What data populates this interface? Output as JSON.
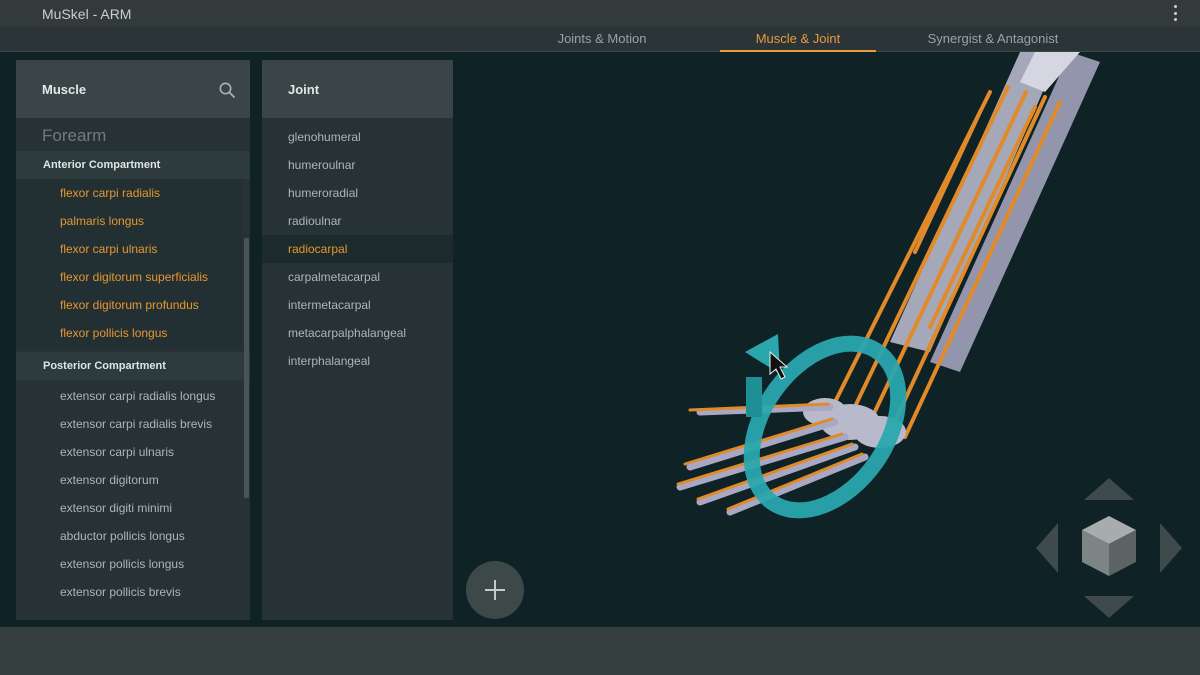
{
  "app": {
    "title": "MuSkel - ARM"
  },
  "tabs": [
    {
      "label": "Joints & Motion"
    },
    {
      "label": "Muscle & Joint"
    },
    {
      "label": "Synergist & Antagonist"
    }
  ],
  "muscle_panel": {
    "title": "Muscle",
    "group": "Forearm",
    "sections": [
      {
        "title": "Anterior Compartment",
        "items": [
          {
            "label": "flexor carpi radialis"
          },
          {
            "label": "palmaris longus"
          },
          {
            "label": "flexor carpi ulnaris"
          },
          {
            "label": "flexor digitorum superficialis"
          },
          {
            "label": "flexor digitorum profundus"
          },
          {
            "label": "flexor pollicis longus"
          }
        ]
      },
      {
        "title": "Posterior Compartment",
        "items": [
          {
            "label": "extensor carpi radialis longus"
          },
          {
            "label": "extensor carpi radialis brevis"
          },
          {
            "label": "extensor carpi ulnaris"
          },
          {
            "label": "extensor digitorum"
          },
          {
            "label": "extensor digiti minimi"
          },
          {
            "label": "abductor pollicis longus"
          },
          {
            "label": "extensor pollicis longus"
          },
          {
            "label": "extensor pollicis brevis"
          }
        ]
      }
    ]
  },
  "joint_panel": {
    "title": "Joint",
    "items": [
      {
        "label": "glenohumeral"
      },
      {
        "label": "humeroulnar"
      },
      {
        "label": "humeroradial"
      },
      {
        "label": "radioulnar"
      },
      {
        "label": "radiocarpal"
      },
      {
        "label": "carpalmetacarpal"
      },
      {
        "label": "intermetacarpal"
      },
      {
        "label": "metacarpalphalangeal"
      },
      {
        "label": "interphalangeal"
      }
    ]
  },
  "colors": {
    "accent": "#e89a3c",
    "background": "#0f2226",
    "panel": "#263234",
    "rotation_ring": "#2aa6ad",
    "bone": "#c9c9d8",
    "muscle_tendon": "#e08a2a"
  },
  "icons": {
    "search": "search-icon",
    "menu": "more-vert-icon",
    "add": "plus-icon",
    "view_cube": "view-cube-icon"
  }
}
